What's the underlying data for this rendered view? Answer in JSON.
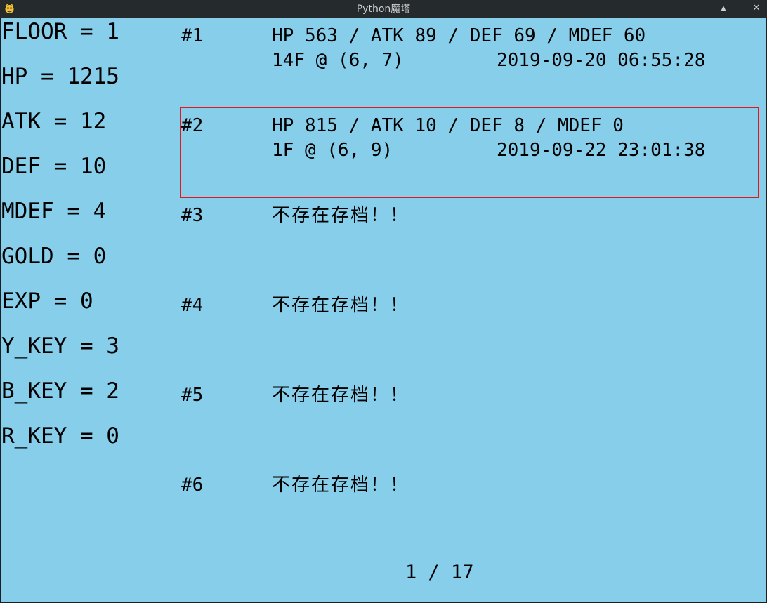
{
  "window": {
    "title": "Python魔塔",
    "app_icon": "pygame-snake-icon",
    "controls": {
      "maximize_glyph": "▲",
      "minimize_glyph": "‒",
      "close_glyph": "✕"
    }
  },
  "colors": {
    "canvas_background": "#87ceeb",
    "text": "#000000",
    "selection_border": "#e8141c",
    "titlebar": "#252a2d"
  },
  "stats": [
    "FLOOR = 1",
    "HP = 1215",
    "ATK = 12",
    "DEF = 10",
    "MDEF = 4",
    "GOLD = 0",
    "EXP = 0",
    "Y_KEY = 3",
    "B_KEY = 2",
    "R_KEY = 0"
  ],
  "save_slots": [
    {
      "number": "#1",
      "line1": "HP 563 / ATK 89 / DEF 69 / MDEF 60",
      "location": "14F @ (6, 7)",
      "date": "2019-09-20 06:55:28",
      "empty": ""
    },
    {
      "number": "#2",
      "line1": "HP 815 / ATK 10 / DEF 8 / MDEF 0",
      "location": "1F @ (6, 9)",
      "date": "2019-09-22 23:01:38",
      "empty": "",
      "selected": true
    },
    {
      "number": "#3",
      "line1": "",
      "location": "",
      "date": "",
      "empty": "不存在存档！！"
    },
    {
      "number": "#4",
      "line1": "",
      "location": "",
      "date": "",
      "empty": "不存在存档！！"
    },
    {
      "number": "#5",
      "line1": "",
      "location": "",
      "date": "",
      "empty": "不存在存档！！"
    },
    {
      "number": "#6",
      "line1": "",
      "location": "",
      "date": "",
      "empty": "不存在存档！！"
    }
  ],
  "pager": {
    "text": "1 / 17"
  }
}
